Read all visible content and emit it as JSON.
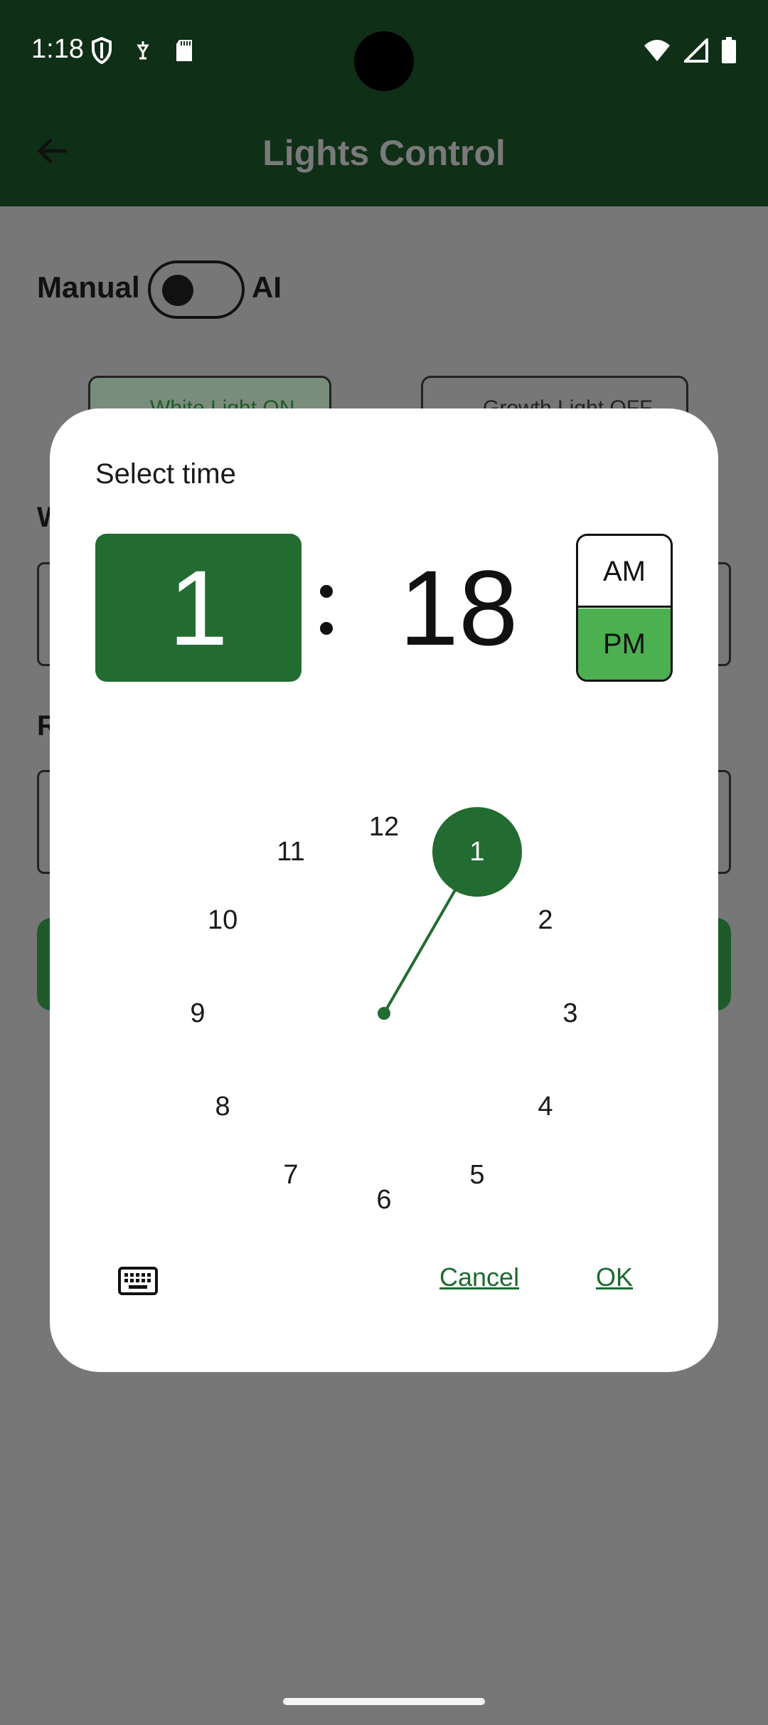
{
  "status_bar": {
    "time": "1:18",
    "left_icons": [
      "shield-icon",
      "vpn-key-icon",
      "sd-card-icon"
    ],
    "right_icons": [
      "wifi-icon",
      "signal-icon",
      "battery-icon"
    ]
  },
  "app_bar": {
    "title": "Lights Control",
    "back_icon": "arrow-back-icon"
  },
  "background": {
    "mode_left": "Manual",
    "mode_right": "AI",
    "chip_white": "White Light ON",
    "chip_growth": "Growth Light OFF",
    "section_1_initial": "W",
    "section_2_initial": "R"
  },
  "dialog": {
    "title": "Select time",
    "hour": "1",
    "minute": "18",
    "am_label": "AM",
    "pm_label": "PM",
    "selected_period": "PM",
    "clock_numbers": [
      "12",
      "1",
      "2",
      "3",
      "4",
      "5",
      "6",
      "7",
      "8",
      "9",
      "10",
      "11"
    ],
    "selected_hour": 1,
    "cancel_label": "Cancel",
    "ok_label": "OK",
    "input_mode_icon": "keyboard-icon"
  },
  "colors": {
    "primary": "#226b31",
    "pm_selected": "#4caf50",
    "link": "#1e6a2f",
    "scrim": "#777777"
  }
}
